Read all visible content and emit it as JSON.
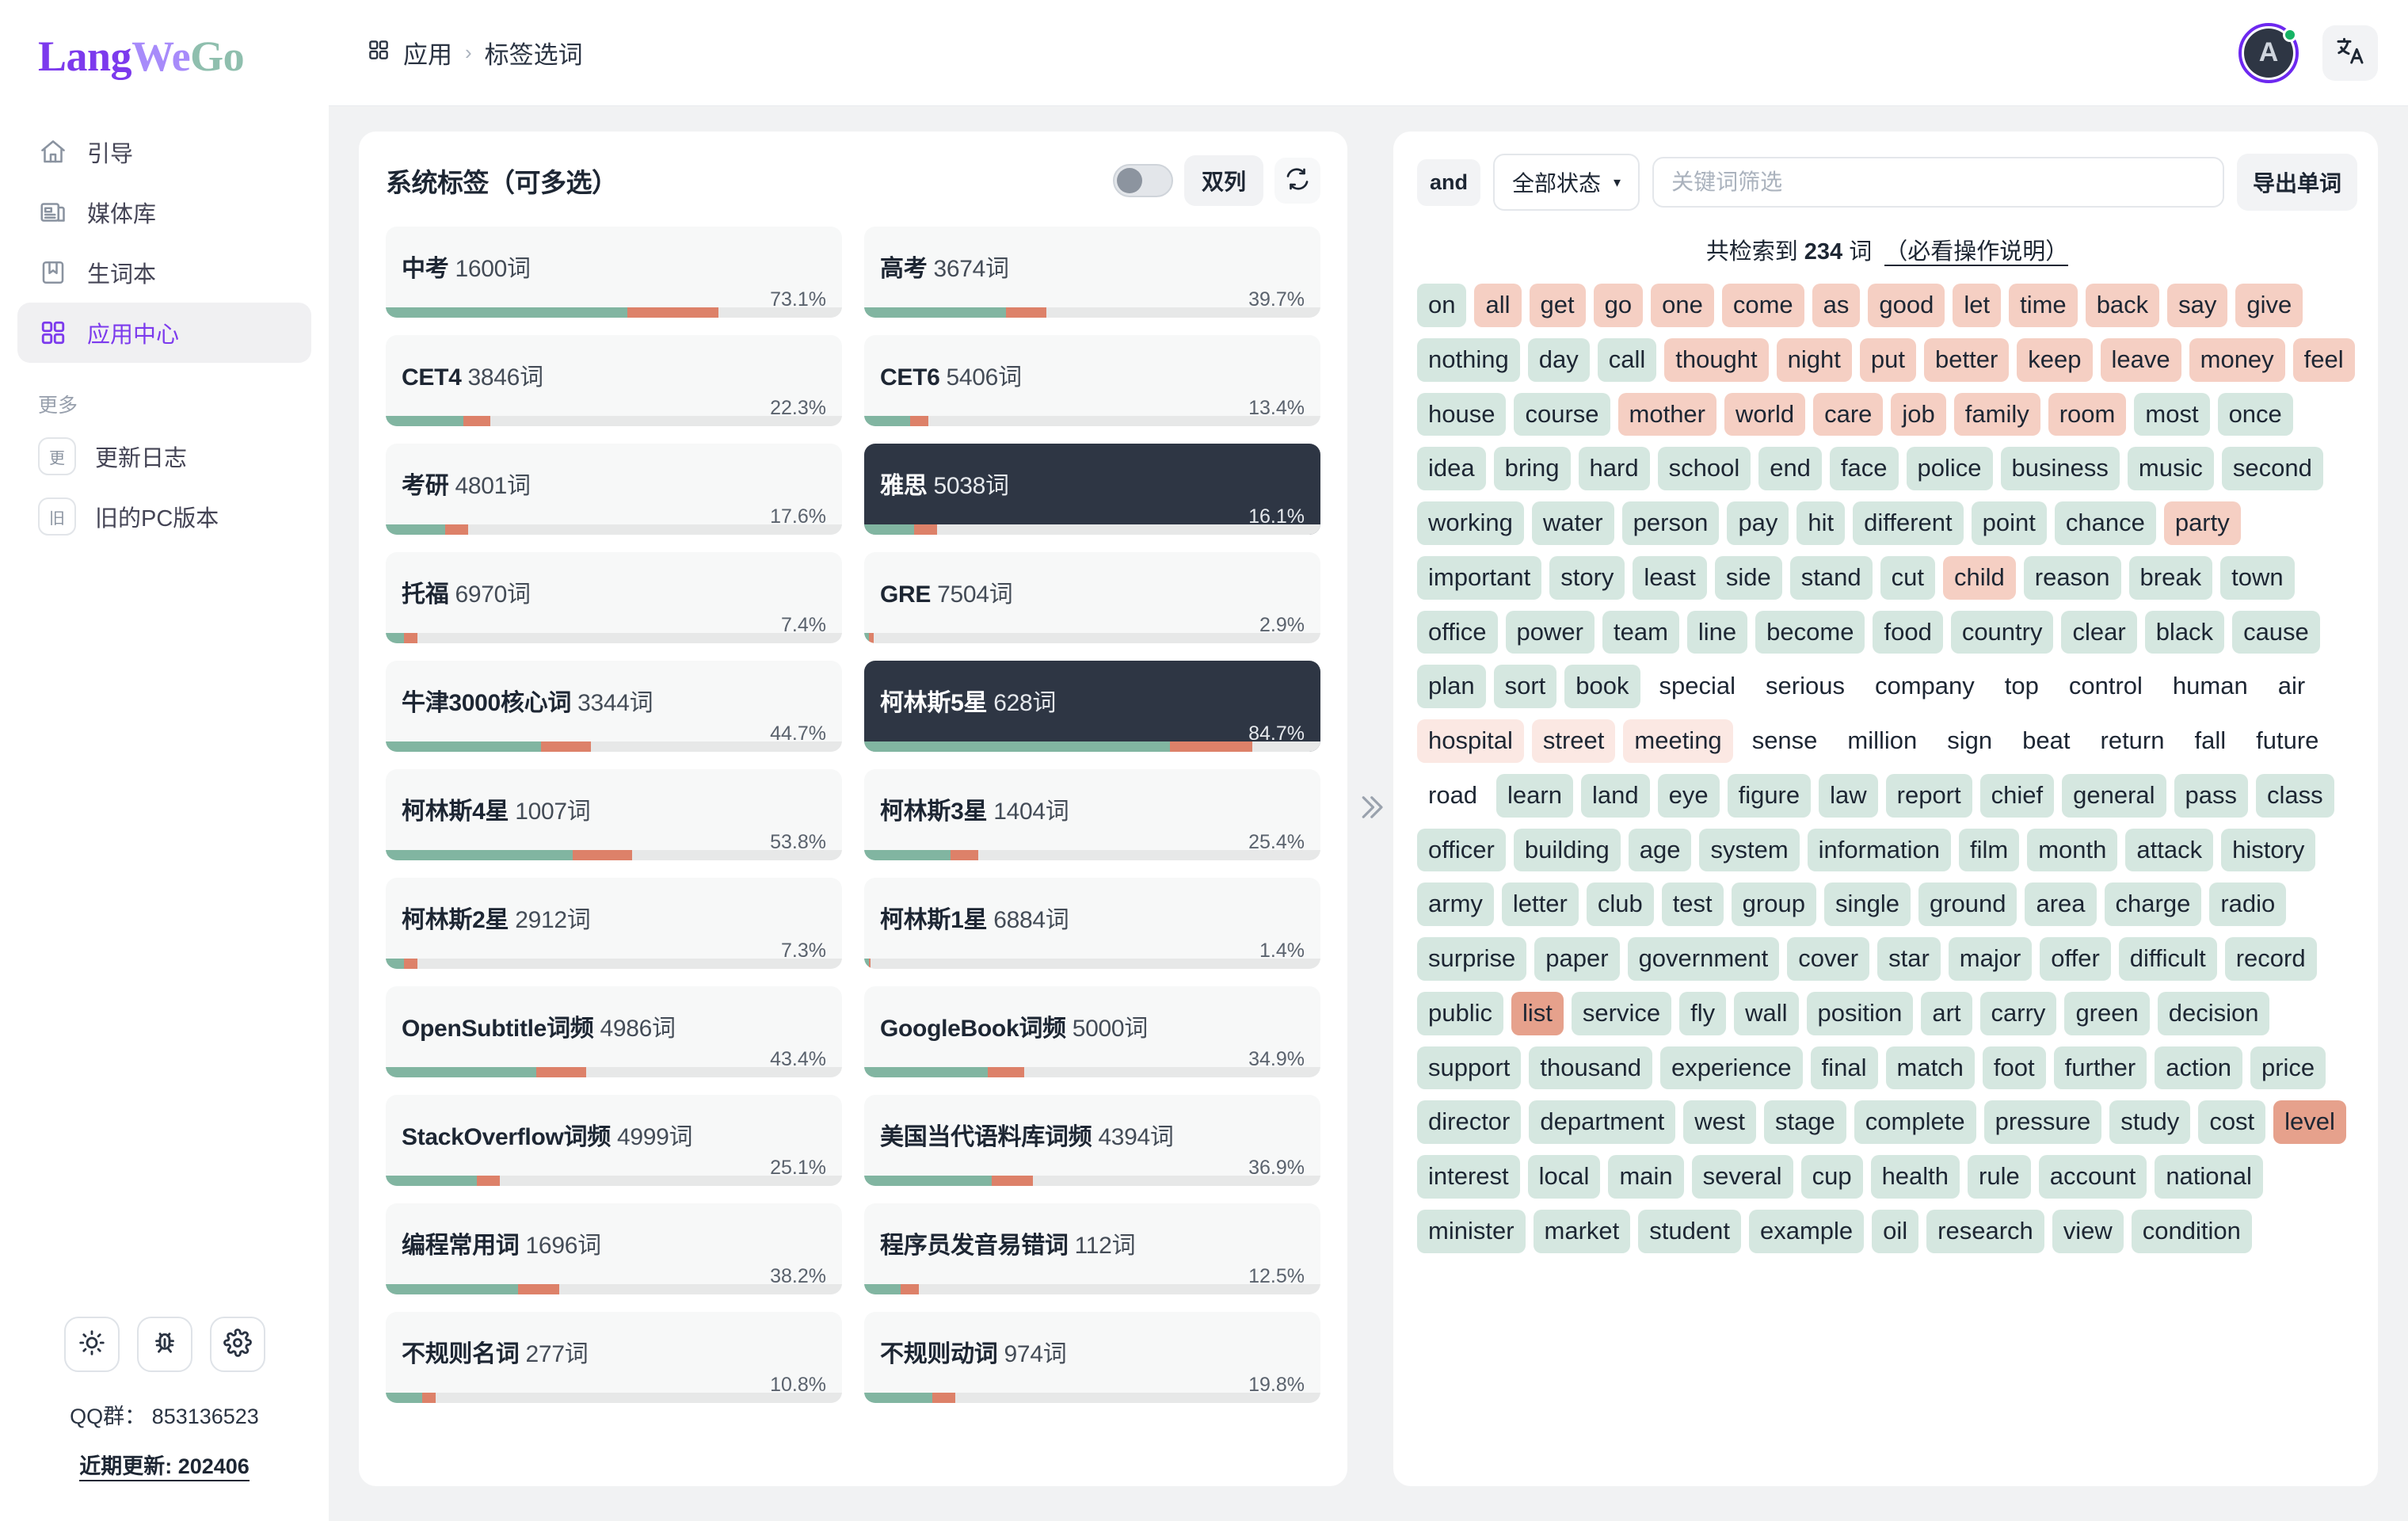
{
  "brand": {
    "part1": "Lang",
    "part2": "We",
    "part3": "Go"
  },
  "sidebar": {
    "items": [
      {
        "label": "引导",
        "icon": "home-icon",
        "active": false
      },
      {
        "label": "媒体库",
        "icon": "media-library-icon",
        "active": false
      },
      {
        "label": "生词本",
        "icon": "bookmark-icon",
        "active": false
      },
      {
        "label": "应用中心",
        "icon": "apps-grid-icon",
        "active": true
      }
    ],
    "more_label": "更多",
    "more_items": [
      {
        "label": "更新日志",
        "badge": "更"
      },
      {
        "label": "旧的PC版本",
        "badge": "旧"
      }
    ],
    "tools": [
      {
        "name": "theme-sun-icon"
      },
      {
        "name": "bug-icon"
      },
      {
        "name": "settings-gear-icon"
      }
    ],
    "qq_text": "QQ群： 853136523",
    "update_text": "近期更新: 202406"
  },
  "topbar": {
    "breadcrumb_root": "应用",
    "breadcrumb_sep": "›",
    "breadcrumb_current": "标签选词",
    "avatar_initial": "A",
    "lang_icon": "translate-icon"
  },
  "tagpanel": {
    "title": "系统标签（可多选）",
    "toggle_on": false,
    "column_btn": "双列",
    "refresh_icon": "refresh-icon",
    "tags": [
      {
        "name": "中考",
        "count": "1600词",
        "pct": "73.1%",
        "green": 53,
        "red": 20,
        "selected": false
      },
      {
        "name": "高考",
        "count": "3674词",
        "pct": "39.7%",
        "green": 31,
        "red": 9,
        "selected": false
      },
      {
        "name": "CET4",
        "count": "3846词",
        "pct": "22.3%",
        "green": 17,
        "red": 6,
        "selected": false
      },
      {
        "name": "CET6",
        "count": "5406词",
        "pct": "13.4%",
        "green": 10,
        "red": 4,
        "selected": false
      },
      {
        "name": "考研",
        "count": "4801词",
        "pct": "17.6%",
        "green": 13,
        "red": 5,
        "selected": false
      },
      {
        "name": "雅思",
        "count": "5038词",
        "pct": "16.1%",
        "green": 11,
        "red": 5,
        "selected": true
      },
      {
        "name": "托福",
        "count": "6970词",
        "pct": "7.4%",
        "green": 4,
        "red": 3,
        "selected": false
      },
      {
        "name": "GRE",
        "count": "7504词",
        "pct": "2.9%",
        "green": 1,
        "red": 1,
        "selected": false
      },
      {
        "name": "牛津3000核心词",
        "count": "3344词",
        "pct": "44.7%",
        "green": 34,
        "red": 11,
        "selected": false
      },
      {
        "name": "柯林斯5星",
        "count": "628词",
        "pct": "84.7%",
        "green": 67,
        "red": 18,
        "selected": true
      },
      {
        "name": "柯林斯4星",
        "count": "1007词",
        "pct": "53.8%",
        "green": 41,
        "red": 13,
        "selected": false
      },
      {
        "name": "柯林斯3星",
        "count": "1404词",
        "pct": "25.4%",
        "green": 19,
        "red": 6,
        "selected": false
      },
      {
        "name": "柯林斯2星",
        "count": "2912词",
        "pct": "7.3%",
        "green": 4,
        "red": 3,
        "selected": false
      },
      {
        "name": "柯林斯1星",
        "count": "6884词",
        "pct": "1.4%",
        "green": 1,
        "red": 0.4,
        "selected": false
      },
      {
        "name": "OpenSubtitle词频",
        "count": "4986词",
        "pct": "43.4%",
        "green": 33,
        "red": 11,
        "selected": false
      },
      {
        "name": "GoogleBook词频",
        "count": "5000词",
        "pct": "34.9%",
        "green": 27,
        "red": 8,
        "selected": false
      },
      {
        "name": "StackOverflow词频",
        "count": "4999词",
        "pct": "25.1%",
        "green": 20,
        "red": 5,
        "selected": false
      },
      {
        "name": "美国当代语料库词频",
        "count": "4394词",
        "pct": "36.9%",
        "green": 28,
        "red": 9,
        "selected": false
      },
      {
        "name": "编程常用词",
        "count": "1696词",
        "pct": "38.2%",
        "green": 29,
        "red": 9,
        "selected": false
      },
      {
        "name": "程序员发音易错词",
        "count": "112词",
        "pct": "12.5%",
        "green": 8,
        "red": 4,
        "selected": false
      },
      {
        "name": "不规则名词",
        "count": "277词",
        "pct": "10.8%",
        "green": 8,
        "red": 3,
        "selected": false
      },
      {
        "name": "不规则动词",
        "count": "974词",
        "pct": "19.8%",
        "green": 15,
        "red": 5,
        "selected": false
      }
    ]
  },
  "collapse_icon": "double-chevron-right-icon",
  "wordpanel": {
    "and_label": "and",
    "status_select": "全部状态",
    "status_caret": "▾",
    "search_placeholder": "关键词筛选",
    "export_label": "导出单词",
    "count_prefix": "共检索到",
    "count_value": "234",
    "count_suffix": "词",
    "count_hint": "（必看操作说明）",
    "colors": {
      "green": "#d5e7e0",
      "pink": "#f5cfc3",
      "lightpink": "#fbe8e3",
      "salmon": "#e6a18c"
    },
    "words": [
      {
        "w": "on",
        "c": "green"
      },
      {
        "w": "all",
        "c": "pink"
      },
      {
        "w": "get",
        "c": "pink"
      },
      {
        "w": "go",
        "c": "pink"
      },
      {
        "w": "one",
        "c": "pink"
      },
      {
        "w": "come",
        "c": "pink"
      },
      {
        "w": "as",
        "c": "pink"
      },
      {
        "w": "good",
        "c": "pink"
      },
      {
        "w": "let",
        "c": "pink"
      },
      {
        "w": "time",
        "c": "pink"
      },
      {
        "w": "back",
        "c": "pink"
      },
      {
        "w": "say",
        "c": "pink"
      },
      {
        "w": "give",
        "c": "pink"
      },
      {
        "w": "nothing",
        "c": "green"
      },
      {
        "w": "day",
        "c": "green"
      },
      {
        "w": "call",
        "c": "green"
      },
      {
        "w": "thought",
        "c": "pink"
      },
      {
        "w": "night",
        "c": "pink"
      },
      {
        "w": "put",
        "c": "pink"
      },
      {
        "w": "better",
        "c": "pink"
      },
      {
        "w": "keep",
        "c": "pink"
      },
      {
        "w": "leave",
        "c": "pink"
      },
      {
        "w": "money",
        "c": "pink"
      },
      {
        "w": "feel",
        "c": "pink"
      },
      {
        "w": "house",
        "c": "green"
      },
      {
        "w": "course",
        "c": "green"
      },
      {
        "w": "mother",
        "c": "pink"
      },
      {
        "w": "world",
        "c": "pink"
      },
      {
        "w": "care",
        "c": "pink"
      },
      {
        "w": "job",
        "c": "pink"
      },
      {
        "w": "family",
        "c": "pink"
      },
      {
        "w": "room",
        "c": "pink"
      },
      {
        "w": "most",
        "c": "green"
      },
      {
        "w": "once",
        "c": "green"
      },
      {
        "w": "idea",
        "c": "green"
      },
      {
        "w": "bring",
        "c": "green"
      },
      {
        "w": "hard",
        "c": "green"
      },
      {
        "w": "school",
        "c": "green"
      },
      {
        "w": "end",
        "c": "green"
      },
      {
        "w": "face",
        "c": "green"
      },
      {
        "w": "police",
        "c": "green"
      },
      {
        "w": "business",
        "c": "green"
      },
      {
        "w": "music",
        "c": "green"
      },
      {
        "w": "second",
        "c": "green"
      },
      {
        "w": "working",
        "c": "green"
      },
      {
        "w": "water",
        "c": "green"
      },
      {
        "w": "person",
        "c": "green"
      },
      {
        "w": "pay",
        "c": "green"
      },
      {
        "w": "hit",
        "c": "green"
      },
      {
        "w": "different",
        "c": "green"
      },
      {
        "w": "point",
        "c": "green"
      },
      {
        "w": "chance",
        "c": "green"
      },
      {
        "w": "party",
        "c": "pink"
      },
      {
        "w": "important",
        "c": "green"
      },
      {
        "w": "story",
        "c": "green"
      },
      {
        "w": "least",
        "c": "green"
      },
      {
        "w": "side",
        "c": "green"
      },
      {
        "w": "stand",
        "c": "green"
      },
      {
        "w": "cut",
        "c": "green"
      },
      {
        "w": "child",
        "c": "pink"
      },
      {
        "w": "reason",
        "c": "green"
      },
      {
        "w": "break",
        "c": "green"
      },
      {
        "w": "town",
        "c": "green"
      },
      {
        "w": "office",
        "c": "green"
      },
      {
        "w": "power",
        "c": "green"
      },
      {
        "w": "team",
        "c": "green"
      },
      {
        "w": "line",
        "c": "green"
      },
      {
        "w": "become",
        "c": "green"
      },
      {
        "w": "food",
        "c": "green"
      },
      {
        "w": "country",
        "c": "green"
      },
      {
        "w": "clear",
        "c": "green"
      },
      {
        "w": "black",
        "c": "green"
      },
      {
        "w": "cause",
        "c": "green"
      },
      {
        "w": "plan",
        "c": "green"
      },
      {
        "w": "sort",
        "c": "green"
      },
      {
        "w": "book",
        "c": "green"
      },
      {
        "w": "special",
        "c": "none"
      },
      {
        "w": "serious",
        "c": "none"
      },
      {
        "w": "company",
        "c": "none"
      },
      {
        "w": "top",
        "c": "none"
      },
      {
        "w": "control",
        "c": "none"
      },
      {
        "w": "human",
        "c": "none"
      },
      {
        "w": "air",
        "c": "none"
      },
      {
        "w": "hospital",
        "c": "lightpink"
      },
      {
        "w": "street",
        "c": "lightpink"
      },
      {
        "w": "meeting",
        "c": "lightpink"
      },
      {
        "w": "sense",
        "c": "none"
      },
      {
        "w": "million",
        "c": "none"
      },
      {
        "w": "sign",
        "c": "none"
      },
      {
        "w": "beat",
        "c": "none"
      },
      {
        "w": "return",
        "c": "none"
      },
      {
        "w": "fall",
        "c": "none"
      },
      {
        "w": "future",
        "c": "none"
      },
      {
        "w": "road",
        "c": "none"
      },
      {
        "w": "learn",
        "c": "green"
      },
      {
        "w": "land",
        "c": "green"
      },
      {
        "w": "eye",
        "c": "green"
      },
      {
        "w": "figure",
        "c": "green"
      },
      {
        "w": "law",
        "c": "green"
      },
      {
        "w": "report",
        "c": "green"
      },
      {
        "w": "chief",
        "c": "green"
      },
      {
        "w": "general",
        "c": "green"
      },
      {
        "w": "pass",
        "c": "green"
      },
      {
        "w": "class",
        "c": "green"
      },
      {
        "w": "officer",
        "c": "green"
      },
      {
        "w": "building",
        "c": "green"
      },
      {
        "w": "age",
        "c": "green"
      },
      {
        "w": "system",
        "c": "green"
      },
      {
        "w": "information",
        "c": "green"
      },
      {
        "w": "film",
        "c": "green"
      },
      {
        "w": "month",
        "c": "green"
      },
      {
        "w": "attack",
        "c": "green"
      },
      {
        "w": "history",
        "c": "green"
      },
      {
        "w": "army",
        "c": "green"
      },
      {
        "w": "letter",
        "c": "green"
      },
      {
        "w": "club",
        "c": "green"
      },
      {
        "w": "test",
        "c": "green"
      },
      {
        "w": "group",
        "c": "green"
      },
      {
        "w": "single",
        "c": "green"
      },
      {
        "w": "ground",
        "c": "green"
      },
      {
        "w": "area",
        "c": "green"
      },
      {
        "w": "charge",
        "c": "green"
      },
      {
        "w": "radio",
        "c": "green"
      },
      {
        "w": "surprise",
        "c": "green"
      },
      {
        "w": "paper",
        "c": "green"
      },
      {
        "w": "government",
        "c": "green"
      },
      {
        "w": "cover",
        "c": "green"
      },
      {
        "w": "star",
        "c": "green"
      },
      {
        "w": "major",
        "c": "green"
      },
      {
        "w": "offer",
        "c": "green"
      },
      {
        "w": "difficult",
        "c": "green"
      },
      {
        "w": "record",
        "c": "green"
      },
      {
        "w": "public",
        "c": "green"
      },
      {
        "w": "list",
        "c": "salmon"
      },
      {
        "w": "service",
        "c": "green"
      },
      {
        "w": "fly",
        "c": "green"
      },
      {
        "w": "wall",
        "c": "green"
      },
      {
        "w": "position",
        "c": "green"
      },
      {
        "w": "art",
        "c": "green"
      },
      {
        "w": "carry",
        "c": "green"
      },
      {
        "w": "green",
        "c": "green"
      },
      {
        "w": "decision",
        "c": "green"
      },
      {
        "w": "support",
        "c": "green"
      },
      {
        "w": "thousand",
        "c": "green"
      },
      {
        "w": "experience",
        "c": "green"
      },
      {
        "w": "final",
        "c": "green"
      },
      {
        "w": "match",
        "c": "green"
      },
      {
        "w": "foot",
        "c": "green"
      },
      {
        "w": "further",
        "c": "green"
      },
      {
        "w": "action",
        "c": "green"
      },
      {
        "w": "price",
        "c": "green"
      },
      {
        "w": "director",
        "c": "green"
      },
      {
        "w": "department",
        "c": "green"
      },
      {
        "w": "west",
        "c": "green"
      },
      {
        "w": "stage",
        "c": "green"
      },
      {
        "w": "complete",
        "c": "green"
      },
      {
        "w": "pressure",
        "c": "green"
      },
      {
        "w": "study",
        "c": "green"
      },
      {
        "w": "cost",
        "c": "green"
      },
      {
        "w": "level",
        "c": "salmon"
      },
      {
        "w": "interest",
        "c": "green"
      },
      {
        "w": "local",
        "c": "green"
      },
      {
        "w": "main",
        "c": "green"
      },
      {
        "w": "several",
        "c": "green"
      },
      {
        "w": "cup",
        "c": "green"
      },
      {
        "w": "health",
        "c": "green"
      },
      {
        "w": "rule",
        "c": "green"
      },
      {
        "w": "account",
        "c": "green"
      },
      {
        "w": "national",
        "c": "green"
      },
      {
        "w": "minister",
        "c": "green"
      },
      {
        "w": "market",
        "c": "green"
      },
      {
        "w": "student",
        "c": "green"
      },
      {
        "w": "example",
        "c": "green"
      },
      {
        "w": "oil",
        "c": "green"
      },
      {
        "w": "research",
        "c": "green"
      },
      {
        "w": "view",
        "c": "green"
      },
      {
        "w": "condition",
        "c": "green"
      }
    ]
  }
}
